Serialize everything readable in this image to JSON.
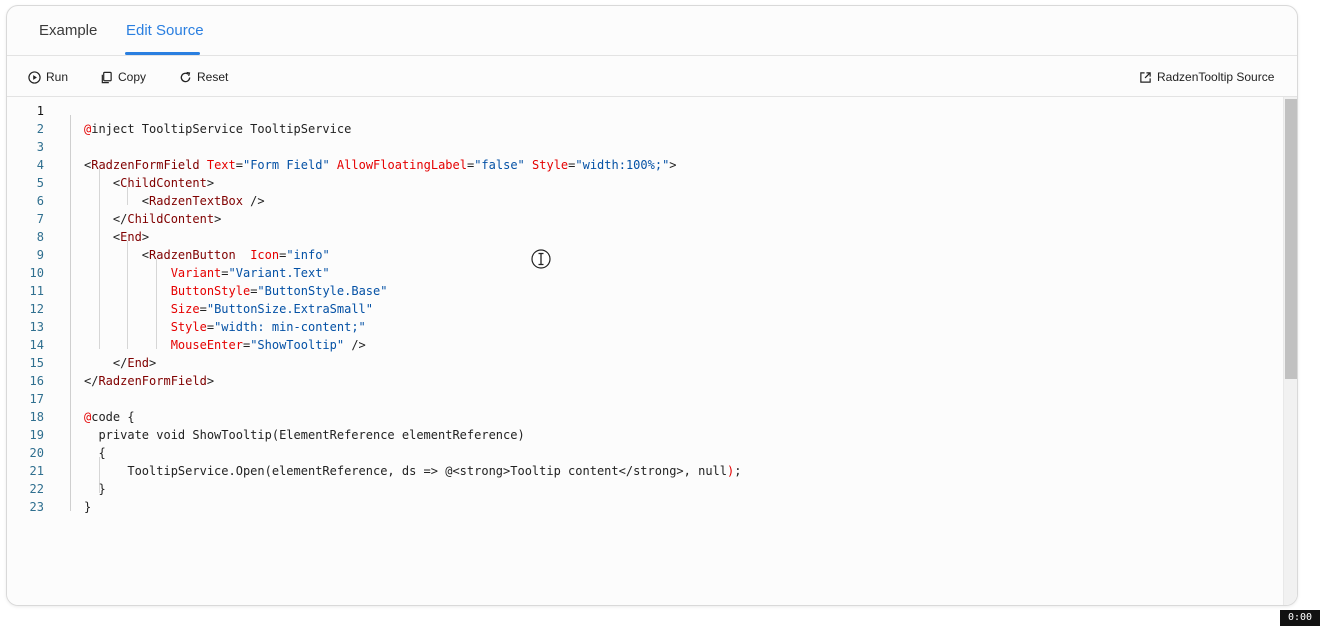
{
  "tabs": [
    {
      "label": "Example",
      "active": false
    },
    {
      "label": "Edit Source",
      "active": true
    }
  ],
  "toolbar": {
    "run_label": "Run",
    "copy_label": "Copy",
    "reset_label": "Reset",
    "source_label": "RadzenTooltip Source"
  },
  "colors": {
    "accent": "#2a7fe0",
    "tag": "#800000",
    "attribute": "#e50000",
    "string": "#0451a5",
    "line_number": "#2f6f8f"
  },
  "editor": {
    "line_numbers": [
      "1",
      "2",
      "3",
      "4",
      "5",
      "6",
      "7",
      "8",
      "9",
      "10",
      "11",
      "12",
      "13",
      "14",
      "15",
      "16",
      "17",
      "18",
      "19",
      "20",
      "21",
      "22",
      "23"
    ],
    "active_line": 1,
    "lines": [
      [],
      [
        [
          "at",
          "@"
        ],
        [
          "p",
          "inject TooltipService TooltipService"
        ]
      ],
      [],
      [
        [
          "p",
          "<"
        ],
        [
          "t",
          "RadzenFormField"
        ],
        [
          "p",
          " "
        ],
        [
          "a",
          "Text"
        ],
        [
          "p",
          "="
        ],
        [
          "s",
          "\"Form Field\""
        ],
        [
          "p",
          " "
        ],
        [
          "a",
          "AllowFloatingLabel"
        ],
        [
          "p",
          "="
        ],
        [
          "s",
          "\"false\""
        ],
        [
          "p",
          " "
        ],
        [
          "a",
          "Style"
        ],
        [
          "p",
          "="
        ],
        [
          "s",
          "\"width:100%;\""
        ],
        [
          "p",
          ">"
        ]
      ],
      [
        [
          "p",
          "    <"
        ],
        [
          "t",
          "ChildContent"
        ],
        [
          "p",
          ">"
        ]
      ],
      [
        [
          "p",
          "        <"
        ],
        [
          "t",
          "RadzenTextBox"
        ],
        [
          "p",
          " />"
        ]
      ],
      [
        [
          "p",
          "    </"
        ],
        [
          "t",
          "ChildContent"
        ],
        [
          "p",
          ">"
        ]
      ],
      [
        [
          "p",
          "    <"
        ],
        [
          "t",
          "End"
        ],
        [
          "p",
          ">"
        ]
      ],
      [
        [
          "p",
          "        <"
        ],
        [
          "t",
          "RadzenButton"
        ],
        [
          "p",
          "  "
        ],
        [
          "a",
          "Icon"
        ],
        [
          "p",
          "="
        ],
        [
          "s",
          "\"info\""
        ]
      ],
      [
        [
          "p",
          "            "
        ],
        [
          "a",
          "Variant"
        ],
        [
          "p",
          "="
        ],
        [
          "s",
          "\"Variant.Text\""
        ]
      ],
      [
        [
          "p",
          "            "
        ],
        [
          "a",
          "ButtonStyle"
        ],
        [
          "p",
          "="
        ],
        [
          "s",
          "\"ButtonStyle.Base\""
        ]
      ],
      [
        [
          "p",
          "            "
        ],
        [
          "a",
          "Size"
        ],
        [
          "p",
          "="
        ],
        [
          "s",
          "\"ButtonSize.ExtraSmall\""
        ]
      ],
      [
        [
          "p",
          "            "
        ],
        [
          "a",
          "Style"
        ],
        [
          "p",
          "="
        ],
        [
          "s",
          "\"width: min-content;\""
        ]
      ],
      [
        [
          "p",
          "            "
        ],
        [
          "a",
          "MouseEnter"
        ],
        [
          "p",
          "="
        ],
        [
          "s",
          "\"ShowTooltip\""
        ],
        [
          "p",
          " />"
        ]
      ],
      [
        [
          "p",
          "    </"
        ],
        [
          "t",
          "End"
        ],
        [
          "p",
          ">"
        ]
      ],
      [
        [
          "p",
          "</"
        ],
        [
          "t",
          "RadzenFormField"
        ],
        [
          "p",
          ">"
        ]
      ],
      [],
      [
        [
          "at",
          "@"
        ],
        [
          "p",
          "code {"
        ]
      ],
      [
        [
          "p",
          "  private void ShowTooltip(ElementReference elementReference)"
        ]
      ],
      [
        [
          "p",
          "  {"
        ]
      ],
      [
        [
          "p",
          "      TooltipService.Open(elementReference, ds => @<strong>Tooltip content</strong>, null"
        ],
        [
          "a",
          ")"
        ],
        [
          "p",
          ";"
        ]
      ],
      [
        [
          "p",
          "  }"
        ]
      ],
      [
        [
          "p",
          "}"
        ]
      ]
    ]
  },
  "timer": "0:00"
}
